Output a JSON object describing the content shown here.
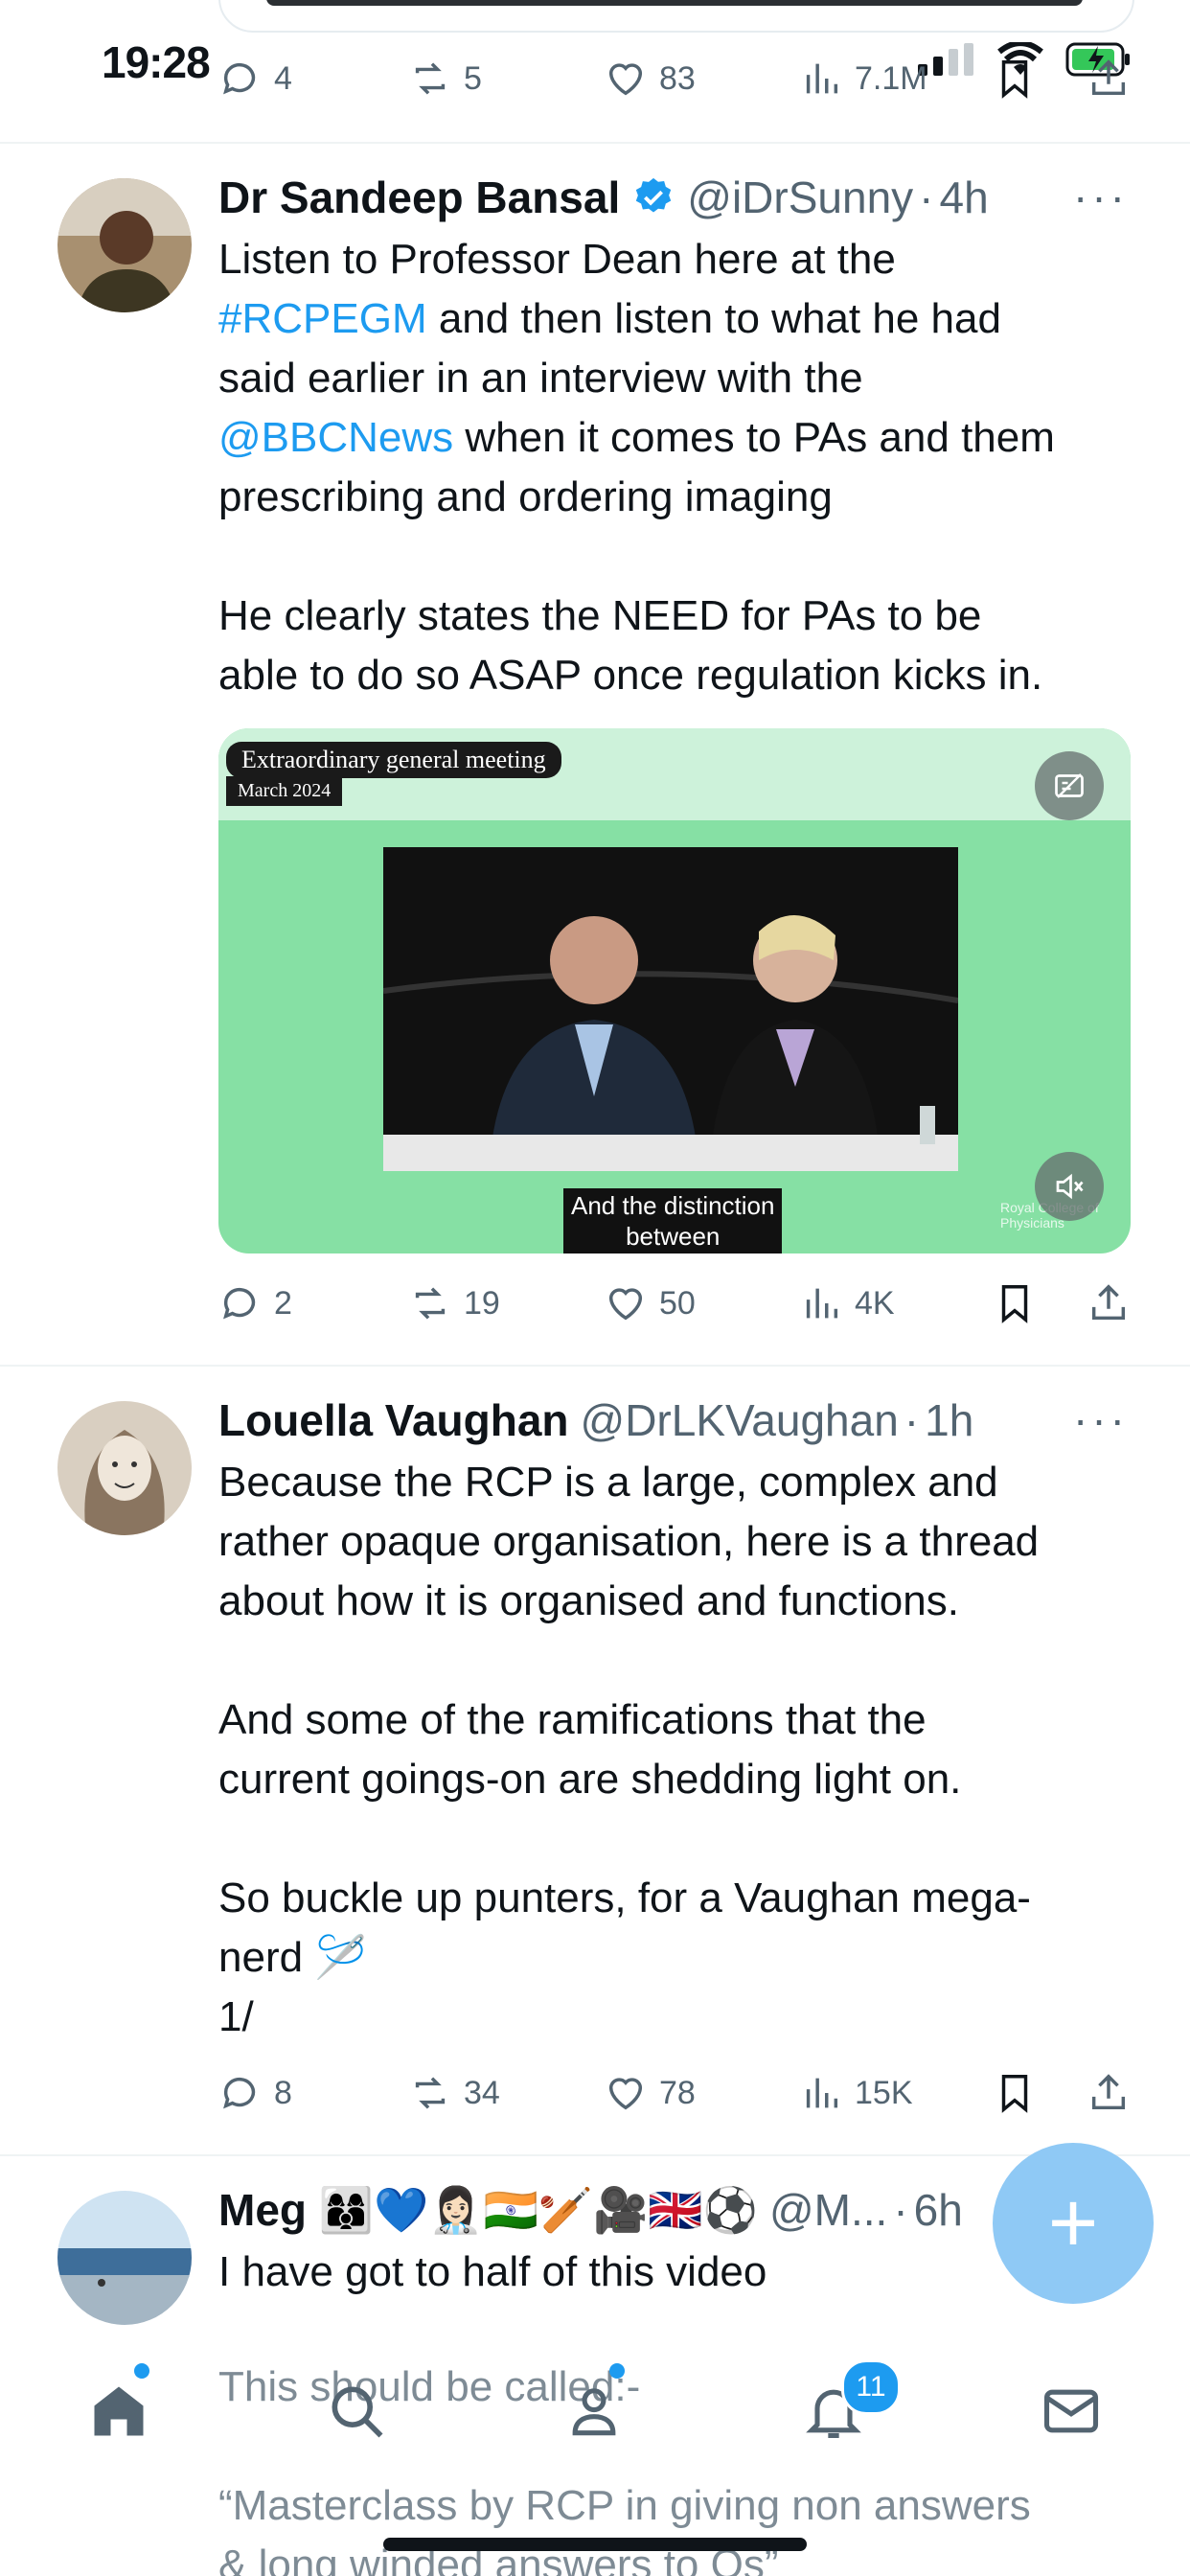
{
  "status_bar": {
    "time": "19:28"
  },
  "prev_tweet": {
    "replies": "4",
    "reposts": "5",
    "likes": "83",
    "views": "7.1M"
  },
  "tweets": [
    {
      "name": "Dr Sandeep Bansal",
      "verified": true,
      "handle": "@iDrSunny",
      "separator": "·",
      "time": "4h",
      "more": "···",
      "body": {
        "l1": "Listen to Professor Dean here at the",
        "l2_link": "#RCPEGM",
        "l2_rest": " and then listen to what he had",
        "l3": "said earlier in an interview with the",
        "l4_link": "@BBCNews",
        "l4_rest": " when it comes to PAs and them",
        "l5": "prescribing and ordering imaging",
        "l6": "He clearly states the NEED for PAs to be",
        "l7": "able to do so ASAP once regulation kicks in."
      },
      "media": {
        "title": "Extraordinary general meeting",
        "subtitle": "March 2024",
        "caption_l1": "And the distinction",
        "caption_l2": "between",
        "watermark": "Royal College of Physicians"
      },
      "replies": "2",
      "reposts": "19",
      "likes": "50",
      "views": "4K"
    },
    {
      "name": "Louella Vaughan",
      "handle": "@DrLKVaughan",
      "separator": "·",
      "time": "1h",
      "more": "···",
      "body": {
        "l1": "Because the RCP is a large, complex and",
        "l2": "rather opaque organisation, here is a thread",
        "l3": "about how it is organised and functions.",
        "l4": "And some of the ramifications that the",
        "l5": "current goings-on are shedding light on.",
        "l6": "So buckle up punters, for a Vaughan mega-",
        "l7": "nerd 🪡",
        "l8": "1/"
      },
      "replies": "8",
      "reposts": "34",
      "likes": "78",
      "views": "15K"
    },
    {
      "name": "Meg 👩‍👩‍👦💙👩🏻‍⚕️🇮🇳🏏🎥🇬🇧⚽",
      "handle": "@M...",
      "separator": "·",
      "time": "6h",
      "more": "···",
      "body": {
        "l1": "I have got to half of this video",
        "l2": "This should be called:-",
        "l3": "“Masterclass by RCP in giving non answers",
        "l4": "& long winded answers to Qs”"
      }
    }
  ],
  "fab": {
    "label": "+"
  },
  "nav": {
    "notifications_badge": "11"
  },
  "colors": {
    "accent": "#1d9bf0",
    "muted": "#536471",
    "media_bg": "#86e0a4"
  }
}
